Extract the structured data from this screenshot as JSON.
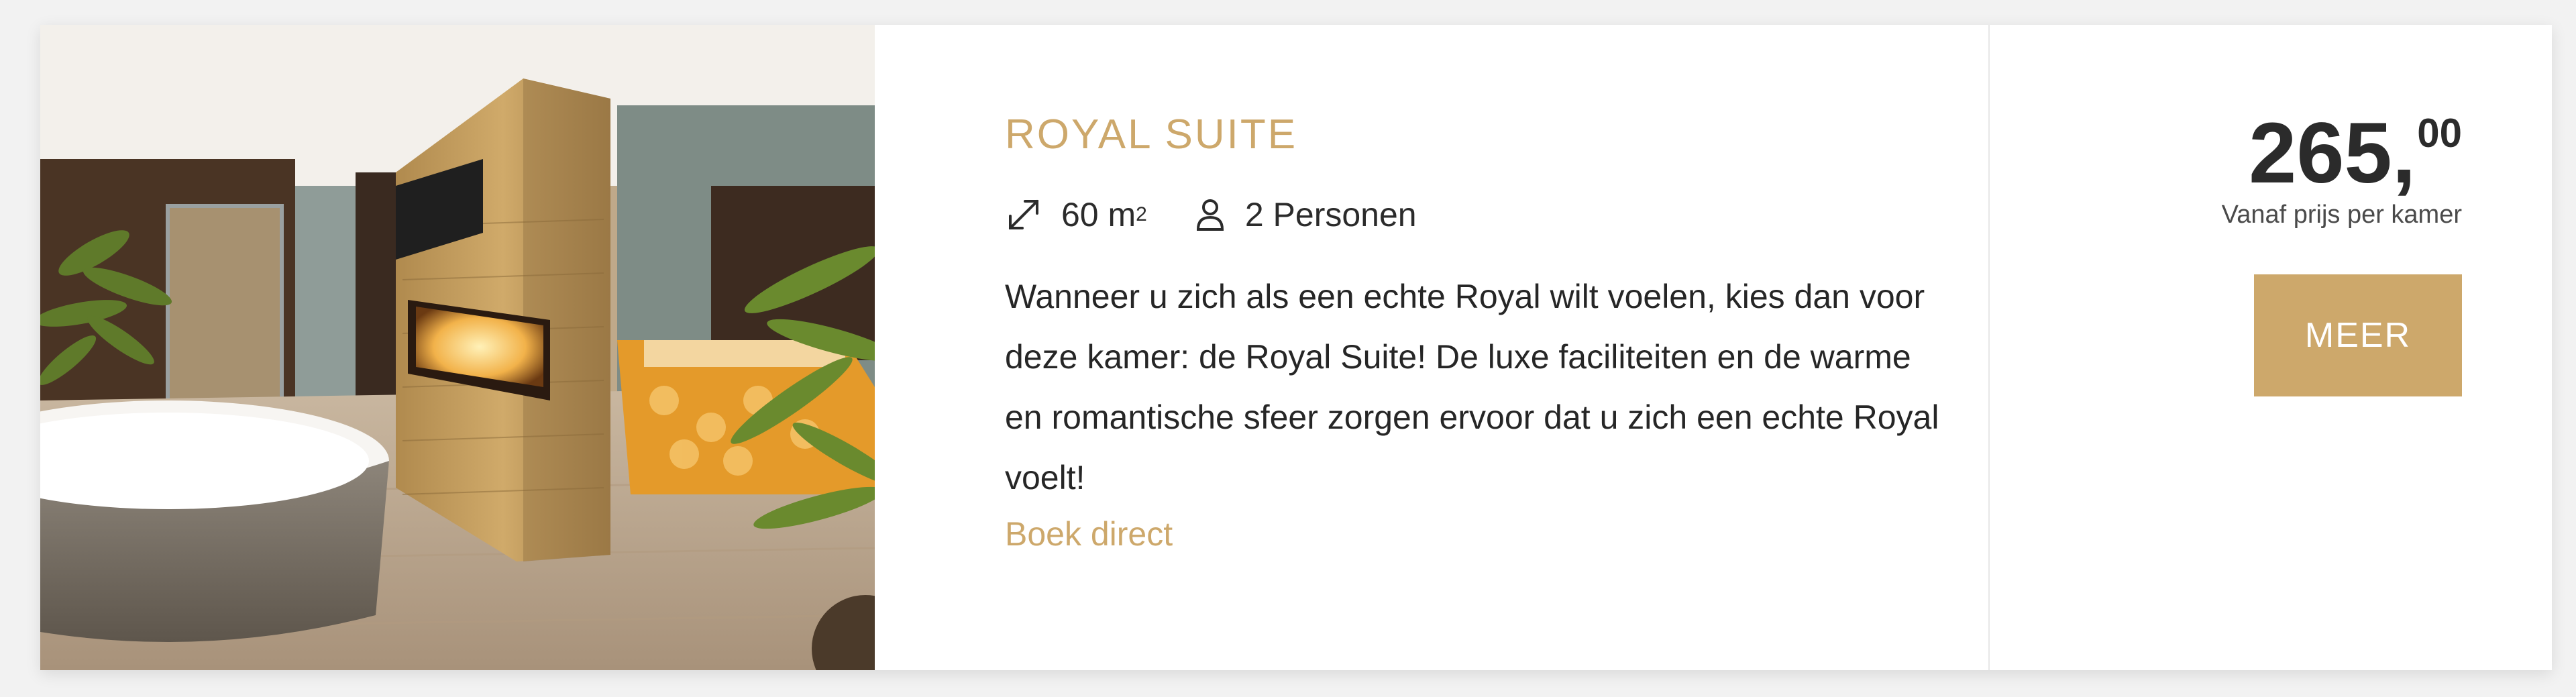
{
  "room": {
    "title": "ROYAL SUITE",
    "size": "60 m",
    "size_unit_sup": "2",
    "persons": "2 Personen",
    "description": "Wanneer u zich als een echte Royal wilt voelen, kies dan voor deze kamer: de Royal Suite! De luxe faciliteiten en de warme en romantische sfeer zorgen ervoor dat u zich een echte Royal voelt!",
    "book_link": "Boek direct",
    "icons": {
      "size": "expand-arrows-icon",
      "persons": "person-icon"
    }
  },
  "pricing": {
    "price_main": "265,",
    "price_cents": "00",
    "price_label": "Vanaf prijs per kamer",
    "button_label": "MEER"
  },
  "colors": {
    "accent": "#cda86b",
    "text": "#262626",
    "background": "#f2f2f2",
    "card": "#ffffff"
  }
}
